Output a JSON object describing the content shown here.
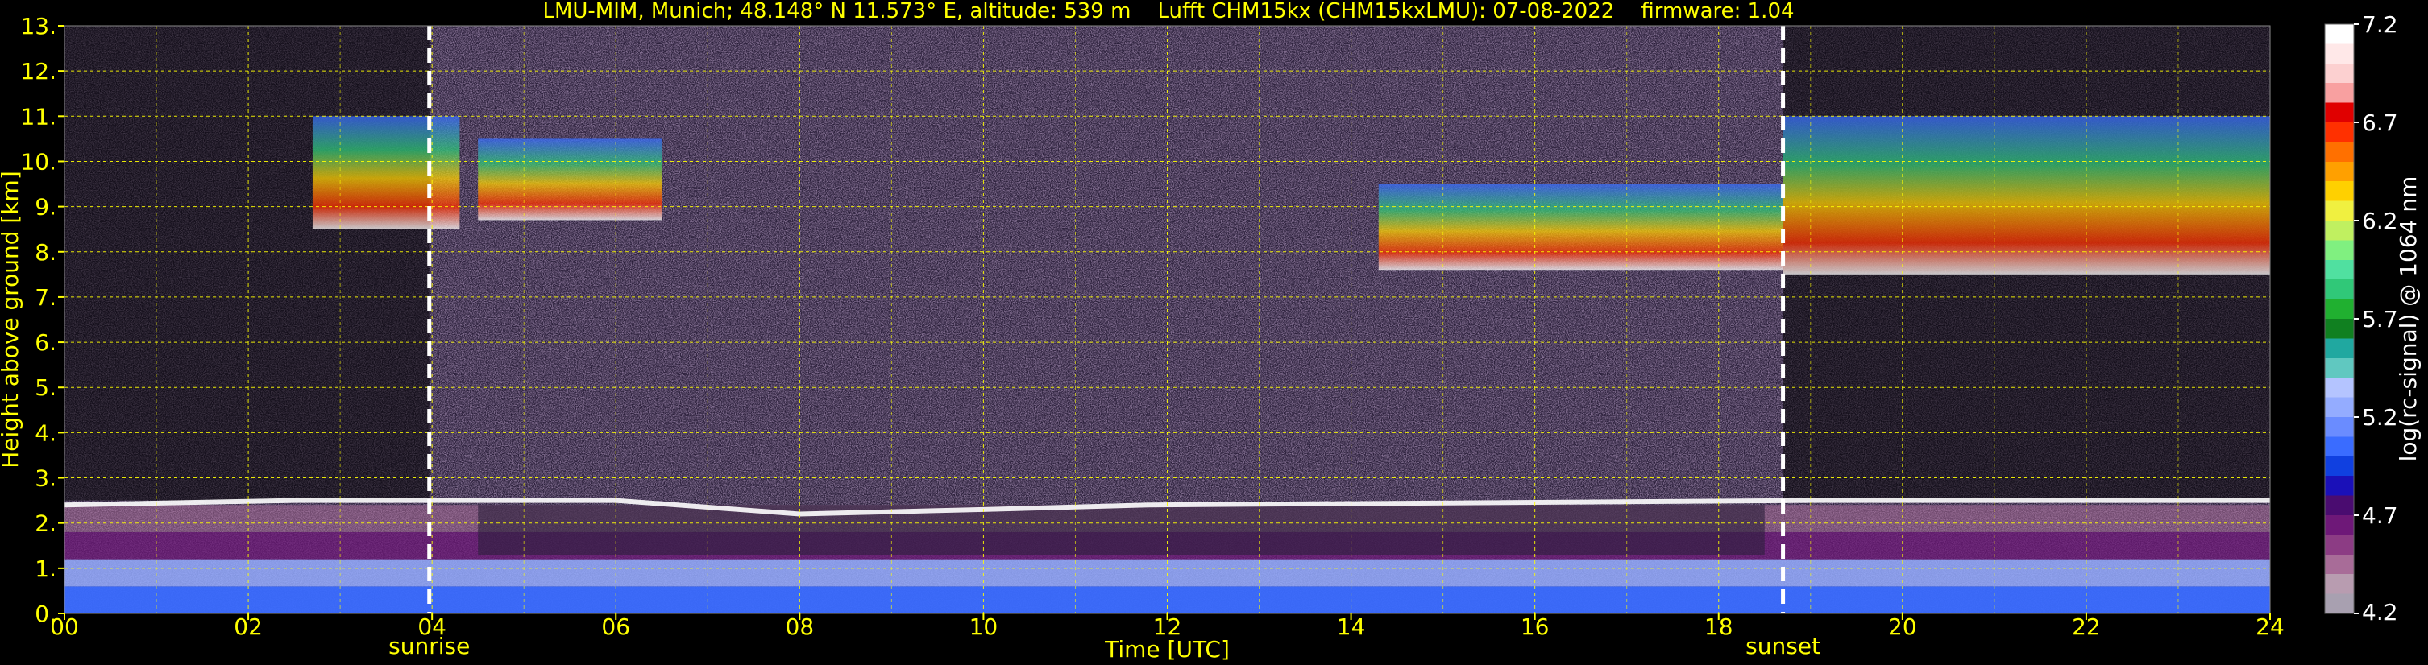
{
  "chart_data": {
    "type": "heatmap",
    "title": "LMU-MIM, Munich; 48.148° N 11.573° E, altitude: 539 m    Lufft CHM15kx (CHM15kxLMU): 07-08-2022    firmware: 1.04",
    "xlabel": "Time [UTC]",
    "ylabel": "Height above ground [km]",
    "colorbar_label": "log(rc-signal) @ 1064 nm",
    "xlim": [
      0,
      24
    ],
    "ylim": [
      0,
      13
    ],
    "x_ticks": [
      0,
      2,
      4,
      6,
      8,
      10,
      12,
      14,
      16,
      18,
      20,
      22,
      24
    ],
    "x_tick_labels": [
      "00",
      "02",
      "04",
      "06",
      "08",
      "10",
      "12",
      "14",
      "16",
      "18",
      "20",
      "22",
      "24"
    ],
    "y_ticks": [
      0,
      1,
      2,
      3,
      4,
      5,
      6,
      7,
      8,
      9,
      10,
      11,
      12,
      13
    ],
    "y_tick_labels": [
      "0.",
      "1.",
      "2.",
      "3.",
      "4.",
      "5.",
      "6.",
      "7.",
      "8.",
      "9.",
      "10.",
      "11.",
      "12.",
      "13."
    ],
    "grid": true,
    "colorbar_range": [
      4.2,
      7.2
    ],
    "colorbar_ticks": [
      4.2,
      4.7,
      5.2,
      5.7,
      6.2,
      6.7,
      7.2
    ],
    "colorbar_tick_labels": [
      "4.2",
      "4.7",
      "5.2",
      "5.7",
      "6.2",
      "6.7",
      "7.2"
    ],
    "colorbar_colors": [
      "#a8a0b0",
      "#b89cb0",
      "#a86c98",
      "#8c3c84",
      "#6e1878",
      "#4a0c70",
      "#1a10b8",
      "#1040e0",
      "#3a6cff",
      "#6a8cff",
      "#94acff",
      "#b4c4ff",
      "#60c8c0",
      "#20a8a0",
      "#108020",
      "#20b030",
      "#30c878",
      "#50e0a0",
      "#80f080",
      "#c0f060",
      "#f0f040",
      "#ffd000",
      "#ffa000",
      "#ff7000",
      "#ff3000",
      "#e00000",
      "#f8a0a0",
      "#fcd0d0",
      "#ffe8e8",
      "#ffffff"
    ],
    "markers": [
      {
        "label": "sunrise",
        "time": 3.97
      },
      {
        "label": "sunset",
        "time": 18.7
      }
    ],
    "features": {
      "boundary_layer_top_km": [
        [
          0,
          2.4
        ],
        [
          2.5,
          2.5
        ],
        [
          4.5,
          2.5
        ],
        [
          6,
          2.5
        ],
        [
          8,
          2.2
        ],
        [
          10,
          2.3
        ],
        [
          11.8,
          2.4
        ],
        [
          19,
          2.5
        ],
        [
          24,
          2.5
        ]
      ],
      "cirrus_layers": [
        {
          "t_start": 2.7,
          "t_end": 4.3,
          "base_km": 8.5,
          "top_km": 11.0
        },
        {
          "t_start": 4.5,
          "t_end": 6.5,
          "base_km": 8.7,
          "top_km": 10.5
        },
        {
          "t_start": 14.3,
          "t_end": 18.7,
          "base_km": 7.6,
          "top_km": 9.5
        },
        {
          "t_start": 18.7,
          "t_end": 24,
          "base_km": 7.5,
          "top_km": 11.0
        }
      ]
    }
  }
}
